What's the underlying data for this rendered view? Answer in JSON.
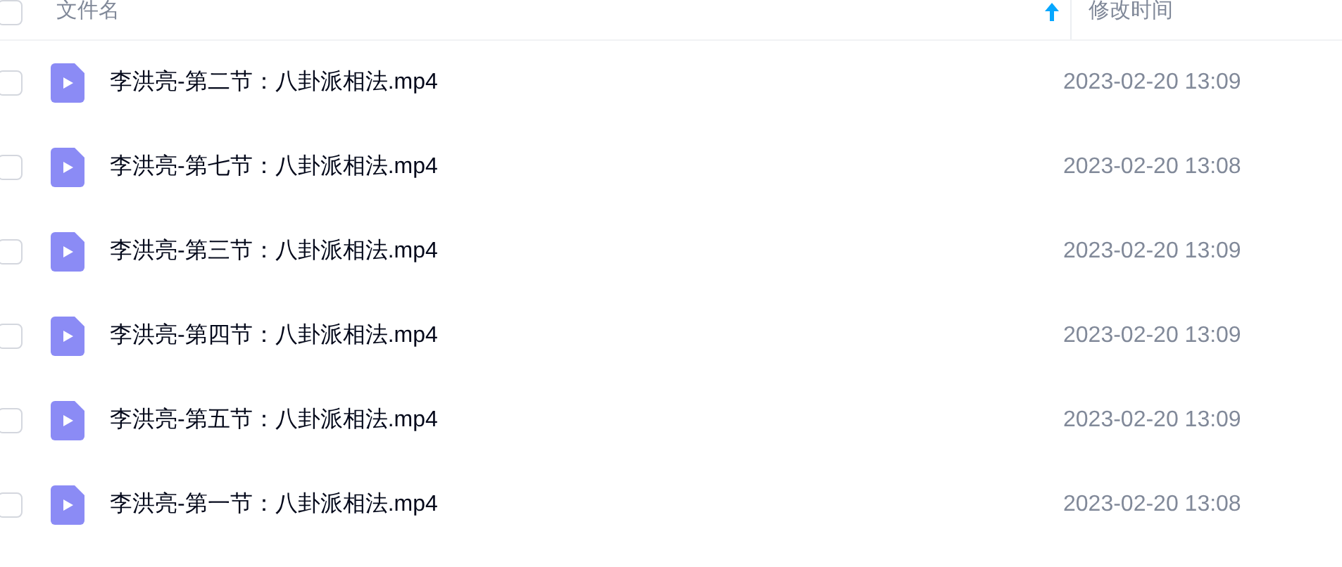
{
  "header": {
    "checked": false,
    "columns": [
      {
        "label": "文件名",
        "sorted": true
      },
      {
        "label": "修改时间",
        "sorted": false
      }
    ]
  },
  "rows": [
    {
      "name": "李洪亮-第二节：八卦派相法.mp4",
      "modified": "2023-02-20 13:09",
      "checked": false
    },
    {
      "name": "李洪亮-第七节：八卦派相法.mp4",
      "modified": "2023-02-20 13:08",
      "checked": false
    },
    {
      "name": "李洪亮-第三节：八卦派相法.mp4",
      "modified": "2023-02-20 13:09",
      "checked": false
    },
    {
      "name": "李洪亮-第四节：八卦派相法.mp4",
      "modified": "2023-02-20 13:09",
      "checked": false
    },
    {
      "name": "李洪亮-第五节：八卦派相法.mp4",
      "modified": "2023-02-20 13:09",
      "checked": false
    },
    {
      "name": "李洪亮-第一节：八卦派相法.mp4",
      "modified": "2023-02-20 13:08",
      "checked": false
    }
  ]
}
